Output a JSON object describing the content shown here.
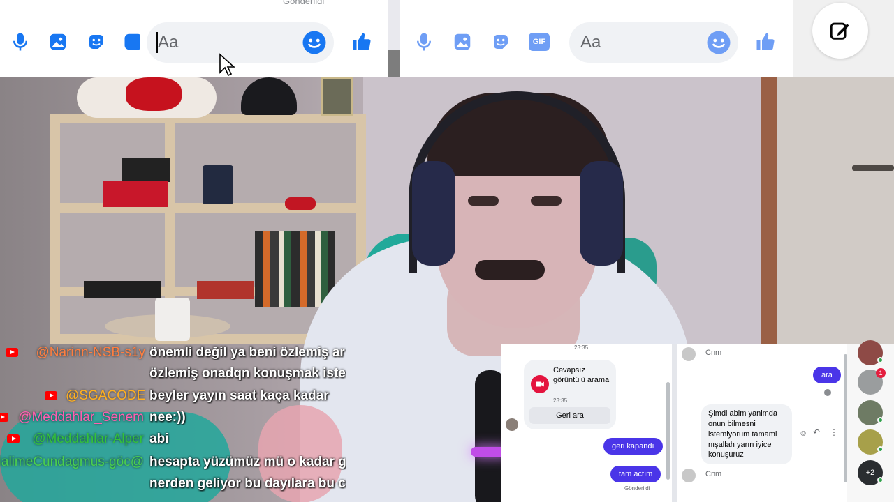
{
  "composer_left": {
    "sent_peek": "Gönderildi",
    "placeholder": "Aa",
    "icons": [
      "microphone-icon",
      "image-icon",
      "sticker-icon",
      "gif-icon",
      "emoji-icon",
      "like-icon"
    ]
  },
  "composer_right": {
    "placeholder": "Aa",
    "gif_label": "GIF",
    "icons": [
      "microphone-icon",
      "image-icon",
      "sticker-icon",
      "gif-icon",
      "emoji-icon",
      "like-icon"
    ]
  },
  "colors": {
    "messenger_blue": "#1877f2",
    "outgoing_bubble": "#4a35e8",
    "call_red": "#e4133e"
  },
  "live_chat": [
    {
      "user": "@Narinn-NSB-s1y",
      "color": "#ff7f40",
      "message": "önemli değil ya beni özlemiş ar",
      "yt_icon": true
    },
    {
      "user": "",
      "color": "#ffffff",
      "message": "özlemiş onadqn konuşmak iste",
      "yt_icon": false
    },
    {
      "user": "@SGACODE",
      "color": "#ffb020",
      "message": "beyler yayın saat kaça kadar",
      "yt_icon": true
    },
    {
      "user": "@Meddahlar_Senem",
      "color": "#ff5fb0",
      "message": "nee:))",
      "yt_icon": true
    },
    {
      "user": "@Meddahlar-Alper",
      "color": "#34c23a",
      "message": "abi",
      "yt_icon": true
    },
    {
      "user": "@HalimeCundagmus-göc",
      "color": "#4bd04e",
      "message": "hesapta yüzümüz mü o kadar g",
      "yt_icon": false
    },
    {
      "user": "",
      "color": "#ffffff",
      "message": "nerden geliyor bu dayılara bu cı",
      "yt_icon": false
    }
  ],
  "messenger_popup": {
    "left_thread": {
      "top_time": "23:35",
      "call_card": {
        "title": "Cevapsız görüntülü arama",
        "time": "23:35",
        "button": "Geri ara"
      },
      "outgoing": [
        "geri kapandı",
        "tam actım"
      ],
      "status": "Gönderildi"
    },
    "right_thread": {
      "incoming_1": "Cnm",
      "outgoing": "ara",
      "incoming_2": "Şimdi abim yanlmda onun bilmesni istemiyorum tamaml nışallah yarın iyice konuşuruz",
      "incoming_3": "Cnm"
    },
    "rail": {
      "badge_count": "1",
      "more_count": "+2"
    }
  }
}
